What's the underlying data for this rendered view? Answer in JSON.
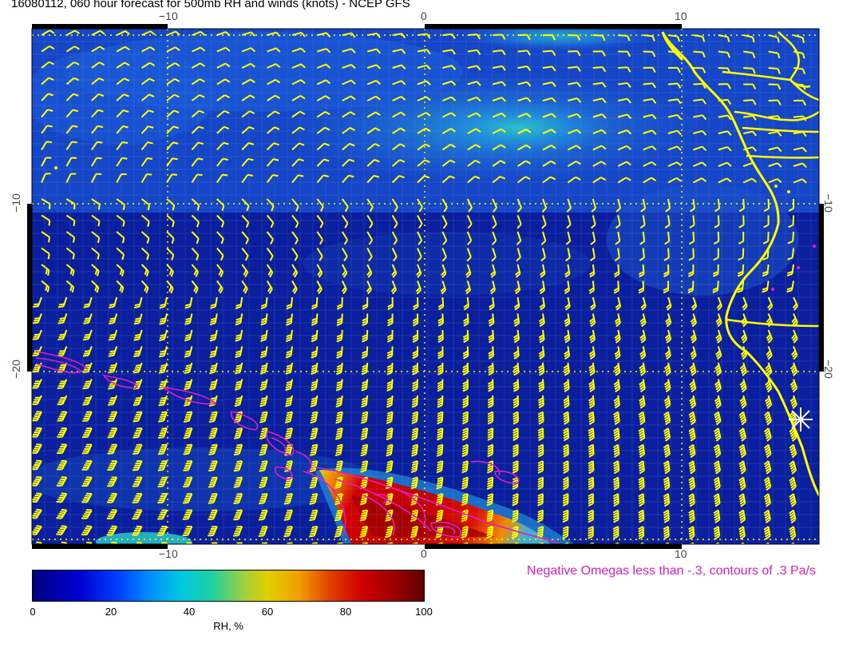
{
  "title": "16080112, 060 hour forecast for 500mb RH and winds (knots) - NCEP GFS",
  "axes": {
    "top_ticks": [
      "−10",
      "0",
      "10"
    ],
    "bottom_ticks": [
      "−10",
      "0",
      "10"
    ],
    "left_ticks": [
      "−10",
      "−20"
    ],
    "right_ticks": [
      "−10",
      "−20"
    ]
  },
  "colorbar": {
    "title": "RH, %",
    "ticks": [
      "0",
      "20",
      "40",
      "60",
      "80",
      "100"
    ],
    "range": [
      0,
      100
    ]
  },
  "omega_note": "Negative Omegas less than -.3, contours of .3 Pa/s",
  "colors": {
    "wind_barbs": "#ffff00",
    "coastline": "#ffff00",
    "omega_contours": "#e01cc8",
    "grid_dotted": "#ffff00",
    "marker": "#ffffff"
  },
  "legend_marker": "star-marker"
}
